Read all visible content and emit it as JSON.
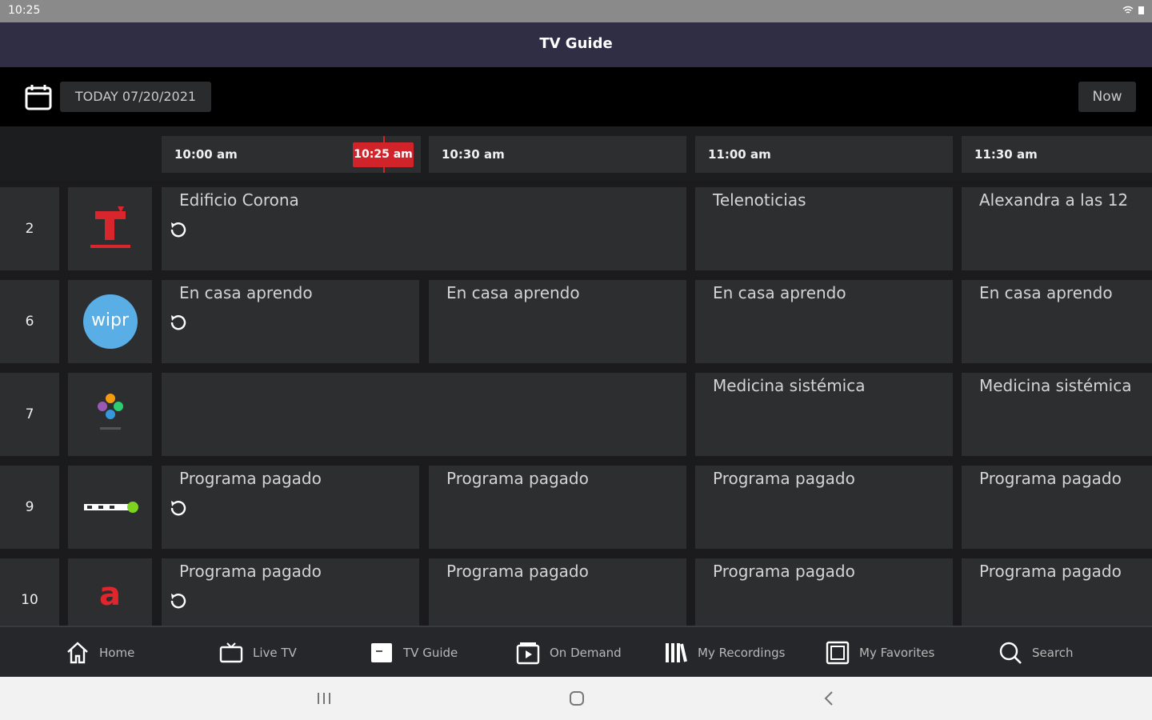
{
  "status_bar": {
    "time": "10:25",
    "icons": "wifi-icon battery-icon"
  },
  "header": {
    "title": "TV Guide"
  },
  "date_bar": {
    "date_label": "TODAY 07/20/2021",
    "now_label": "Now"
  },
  "timeline": {
    "slots": [
      "10:00 am",
      "10:30 am",
      "11:00 am",
      "11:30 am"
    ],
    "current_time": "10:25 am"
  },
  "channels": [
    {
      "number": "2",
      "logo": "telemundo-logo",
      "programs": [
        "Edificio Corona",
        "Telenoticias",
        "Alexandra a las 12"
      ]
    },
    {
      "number": "6",
      "logo": "wipr-logo",
      "logo_text": "wipr",
      "programs": [
        "En casa aprendo",
        "En casa aprendo",
        "En casa aprendo",
        "En casa aprendo"
      ]
    },
    {
      "number": "7",
      "logo": "teleoro-logo",
      "programs": [
        "",
        "Medicina sistémica",
        "Medicina sistémica"
      ]
    },
    {
      "number": "9",
      "logo": "punto2-logo",
      "programs": [
        "Programa pagado",
        "Programa pagado",
        "Programa pagado",
        "Programa pagado"
      ]
    },
    {
      "number": "10",
      "logo": "a-logo",
      "logo_text": "a",
      "programs": [
        "Programa pagado",
        "Programa pagado",
        "Programa pagado",
        "Programa pagado"
      ]
    }
  ],
  "bottom_nav": [
    {
      "label": "Home",
      "icon": "home-icon"
    },
    {
      "label": "Live TV",
      "icon": "tv-icon"
    },
    {
      "label": "TV Guide",
      "icon": "guide-icon"
    },
    {
      "label": "On Demand",
      "icon": "ondemand-icon"
    },
    {
      "label": "My Recordings",
      "icon": "recordings-icon"
    },
    {
      "label": "My Favorites",
      "icon": "favorites-icon"
    },
    {
      "label": "Search",
      "icon": "search-icon"
    }
  ],
  "colors": {
    "accent": "#d1232a",
    "header_bg": "#2f2e44",
    "cell_bg": "#2d2e30",
    "wipr_blue": "#5aaee6"
  }
}
